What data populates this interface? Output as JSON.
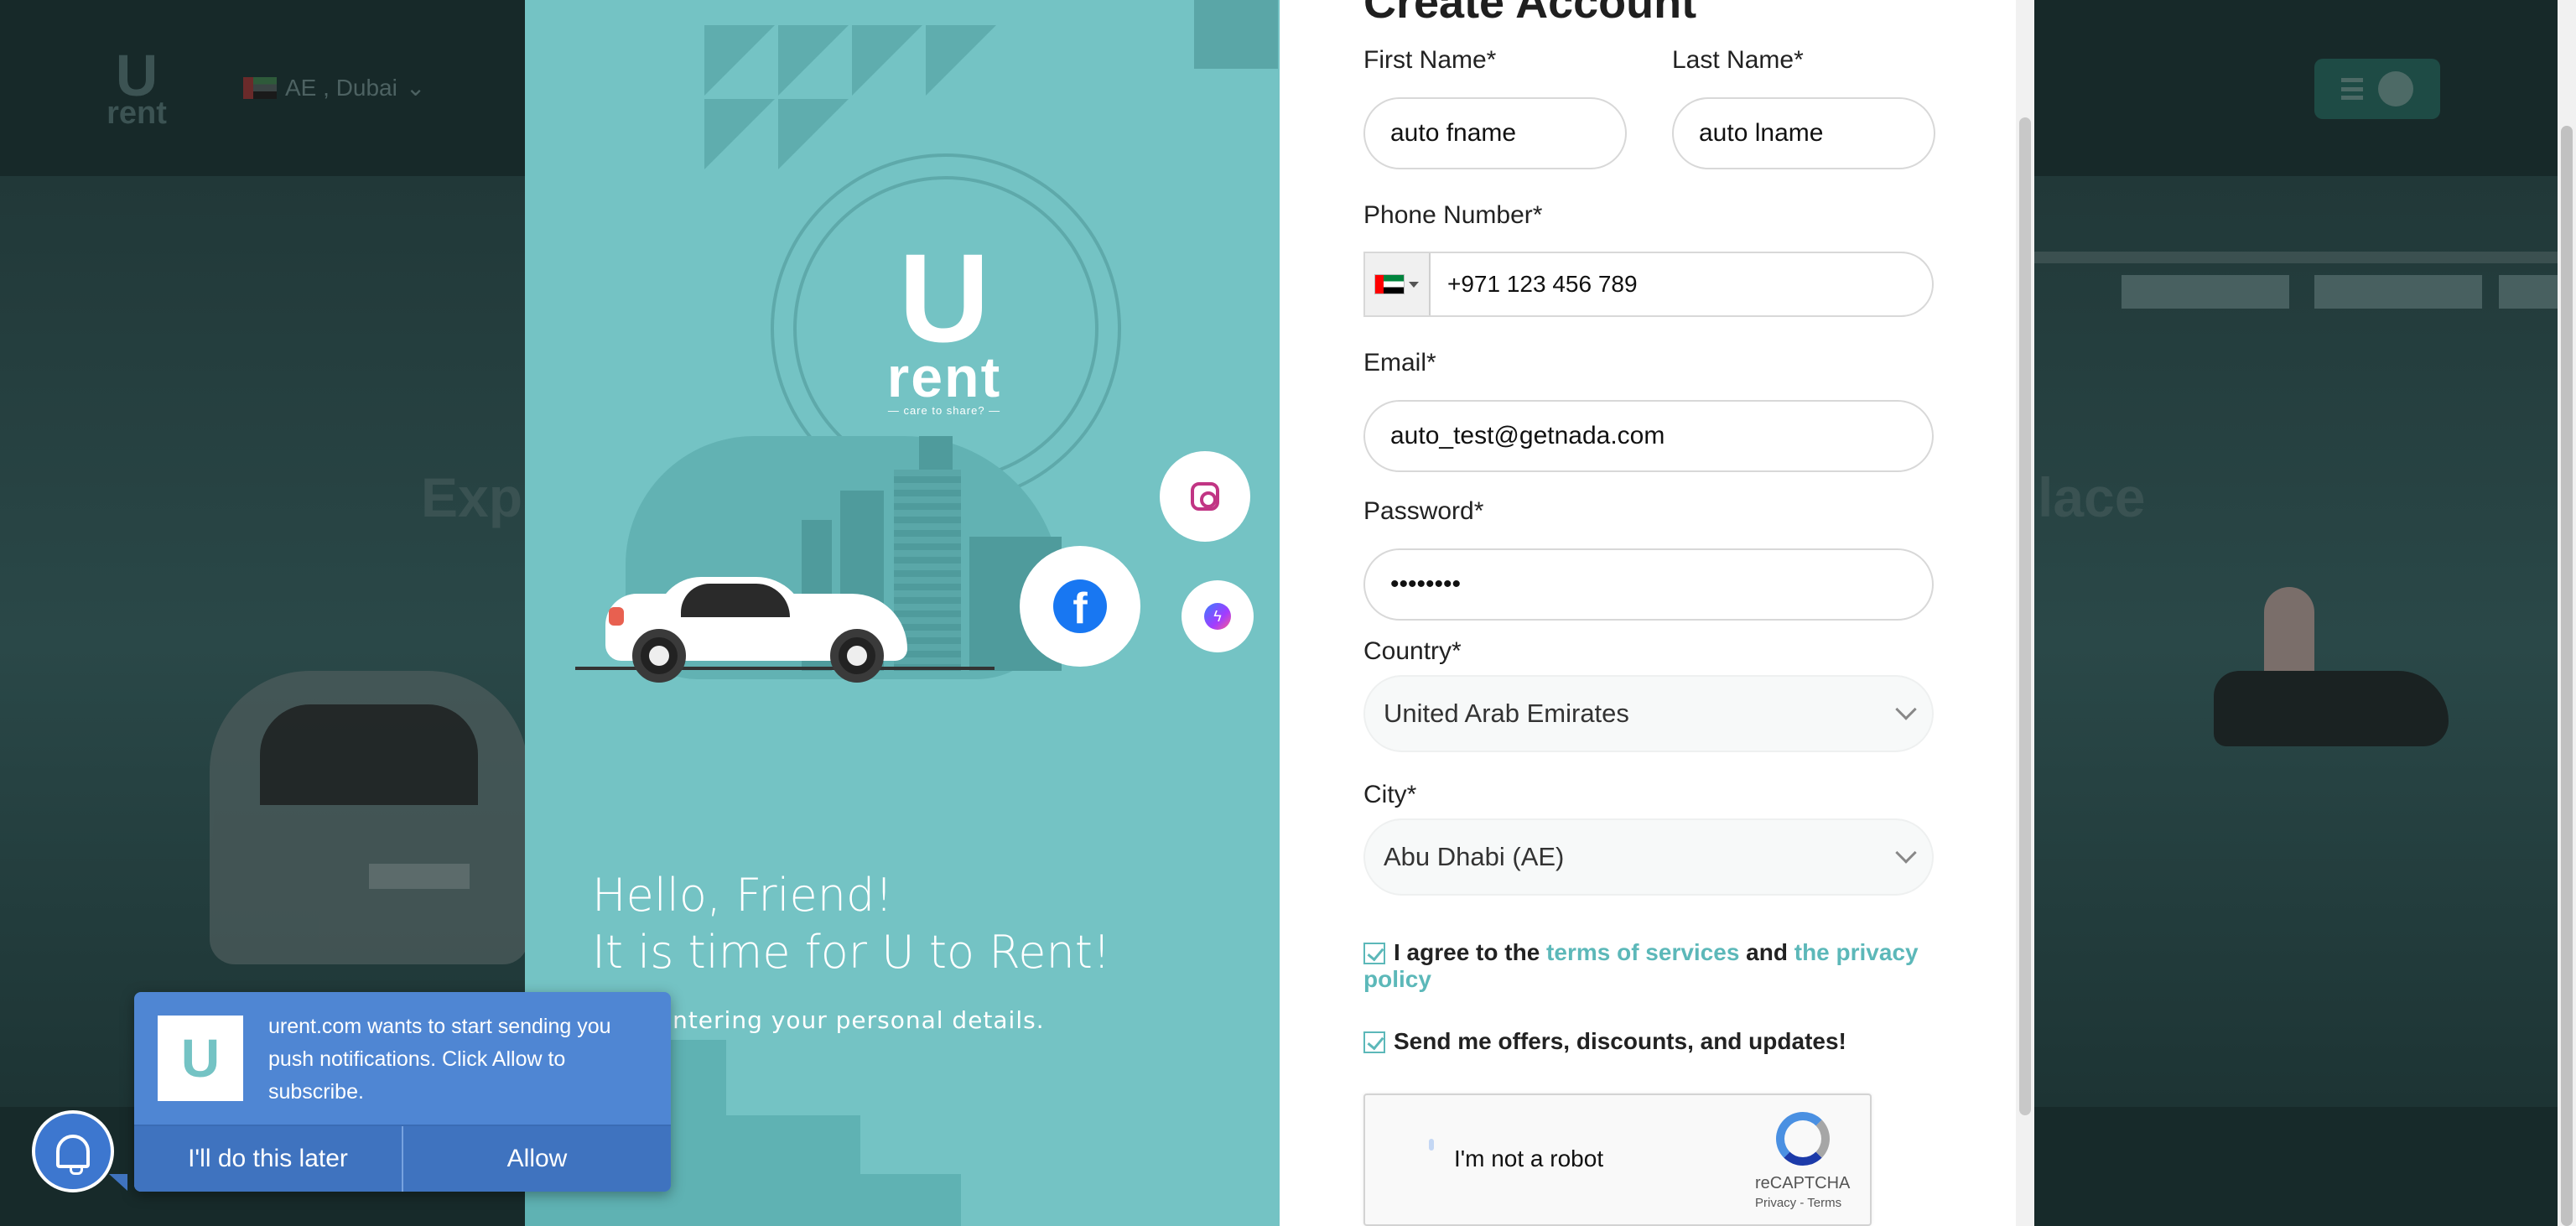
{
  "background": {
    "locale": "AE , Dubai",
    "hero_text_left": "Exp",
    "hero_text_right": "lace"
  },
  "modal": {
    "left": {
      "logo_u": "U",
      "logo_rent": "rent",
      "logo_tagline": "— care to share? —",
      "hello_line1": "Hello, Friend!",
      "hello_line2": "It is time for U to Rent!",
      "subline": "ff by entering your personal details."
    },
    "form": {
      "title": "Create Account",
      "first_name_label": "First Name*",
      "first_name_value": "auto fname",
      "last_name_label": "Last Name*",
      "last_name_value": "auto lname",
      "phone_label": "Phone Number*",
      "phone_value": "+971 123 456 789",
      "email_label": "Email*",
      "email_value": "auto_test@getnada.com",
      "password_label": "Password*",
      "password_value": "••••••••",
      "country_label": "Country*",
      "country_value": "United Arab Emirates",
      "city_label": "City*",
      "city_value": "Abu Dhabi (AE)",
      "agree_prefix": "I agree to the ",
      "terms_link": "terms of services",
      "agree_and": " and ",
      "privacy_link": "the privacy policy",
      "offers_label": "Send me offers, discounts, and updates!",
      "captcha_label": "I'm not a robot",
      "captcha_brand": "reCAPTCHA",
      "captcha_links": "Privacy - Terms"
    }
  },
  "push": {
    "message": "urent.com wants to start sending you push notifications. Click Allow to subscribe.",
    "later_button": "I'll do this later",
    "allow_button": "Allow"
  },
  "colors": {
    "brand_teal": "#74c3c4",
    "link_teal": "#5cb8b9",
    "push_blue": "#4f86d3"
  }
}
